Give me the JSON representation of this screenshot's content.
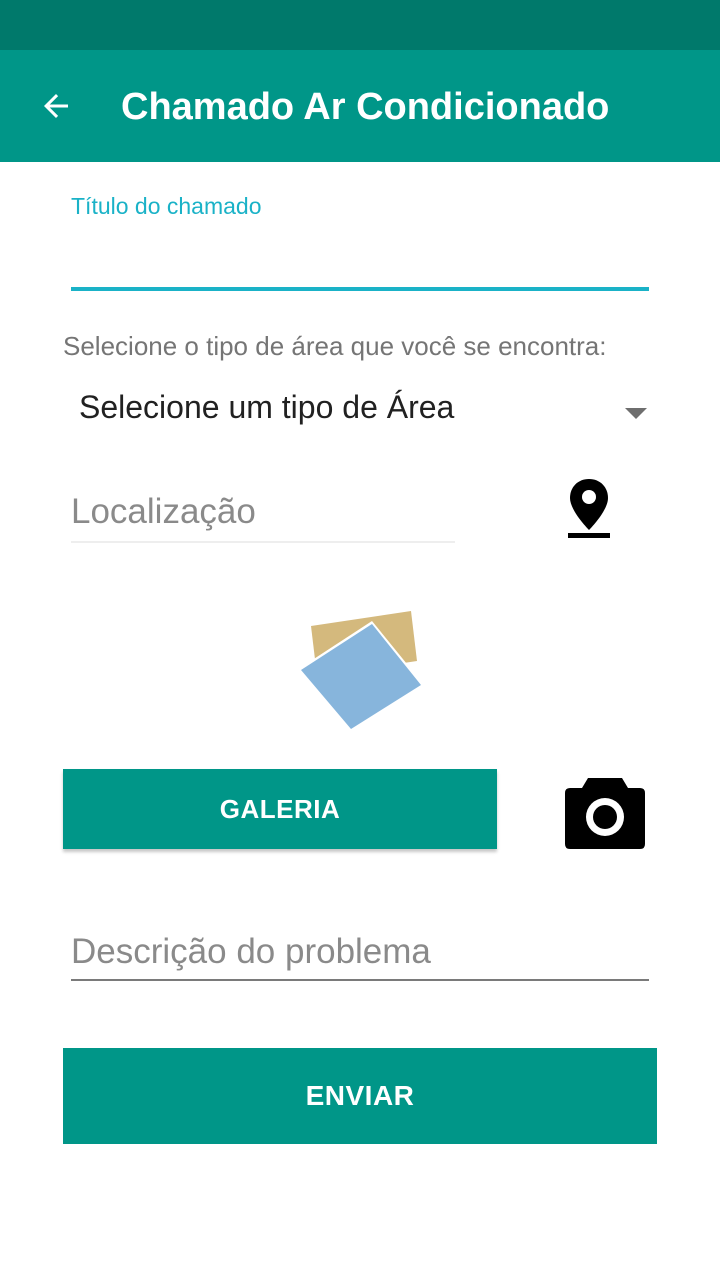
{
  "colors": {
    "status_bar": "#00796b",
    "app_bar": "#009688",
    "accent": "#1ab2c7",
    "button": "#009688",
    "button_text": "#ffffff"
  },
  "app_bar": {
    "back_icon": "arrow-back-icon",
    "title": "Chamado Ar Condicionado"
  },
  "form": {
    "title_field": {
      "label": "Título do chamado",
      "value": ""
    },
    "area": {
      "prompt": "Selecione o tipo de área que você se encontra:",
      "selected": "Selecione um tipo de Área",
      "arrow_icon": "dropdown-arrow-icon"
    },
    "location": {
      "placeholder": "Localização",
      "icon": "location-pin-icon"
    },
    "photo": {
      "icon": "photos-placeholder-icon"
    },
    "gallery_button": "GALERIA",
    "camera_icon": "camera-icon",
    "description": {
      "placeholder": "Descrição do problema"
    },
    "submit_button": "ENVIAR"
  }
}
